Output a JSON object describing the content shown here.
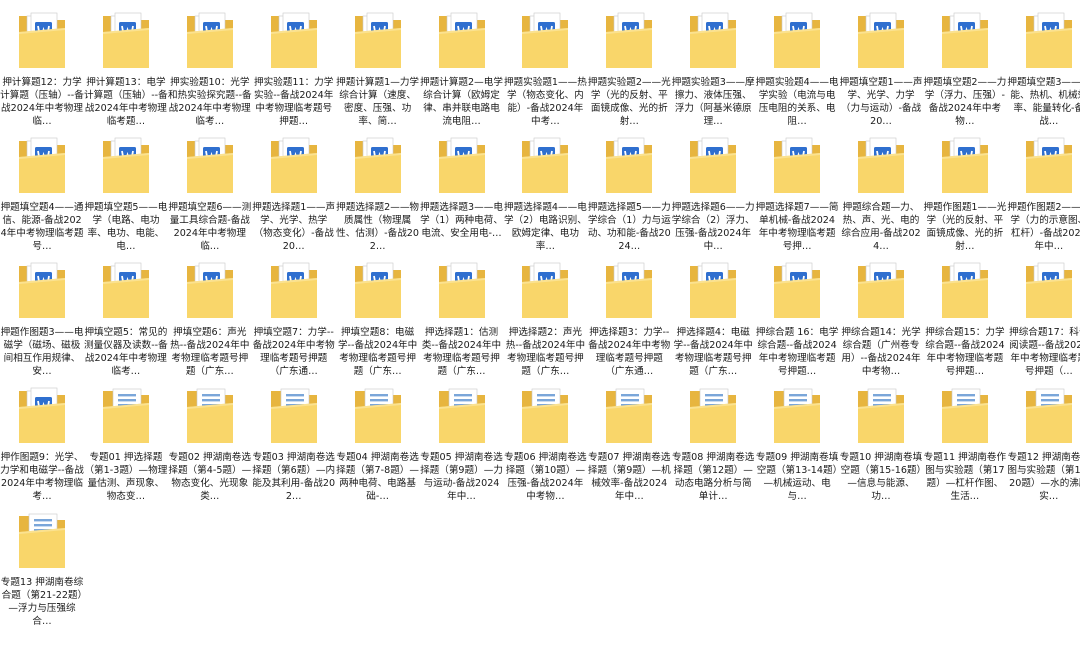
{
  "colors": {
    "folder_front": "#f9d66a",
    "folder_back": "#e7b53f",
    "doc_icon": "#2f6fcf",
    "paper": "#ffffff"
  },
  "items": [
    {
      "label": "押计算题12：力学计算题（压轴）--备战2024年中考物理临…",
      "icon": "word-doc-folder-icon"
    },
    {
      "label": "押计算题13：电学计算题（压轴）--备战2024年中考物理临考题…",
      "icon": "word-doc-folder-icon"
    },
    {
      "label": "押实验题10：光学和热实验探究题--备战2024年中考物理临考…",
      "icon": "word-doc-folder-icon"
    },
    {
      "label": "押实验题11：力学实验--备战2024年中考物理临考题号押题…",
      "icon": "word-doc-folder-icon"
    },
    {
      "label": "押题计算题1—力学综合计算（速度、密度、压强、功率、简…",
      "icon": "word-doc-folder-icon"
    },
    {
      "label": "押题计算题2—电学综合计算（欧姆定律、串并联电路电流电阻…",
      "icon": "word-doc-folder-icon"
    },
    {
      "label": "押题实验题1——热学（物态变化、内能）-备战2024年中考…",
      "icon": "word-doc-folder-icon"
    },
    {
      "label": "押题实验题2——光学（光的反射、平面镜成像、光的折射…",
      "icon": "word-doc-folder-icon"
    },
    {
      "label": "押题实验题3——摩擦力、液体压强、浮力（阿基米德原理…",
      "icon": "word-doc-folder-icon"
    },
    {
      "label": "押题实验题4——电学实验（电流与电压电阻的关系、电阻…",
      "icon": "word-doc-folder-icon"
    },
    {
      "label": "押题填空题1——声学、光学、力学（力与运动）-备战20…",
      "icon": "word-doc-folder-icon"
    },
    {
      "label": "押题填空题2——力学（浮力、压强）-备战2024年中考物…",
      "icon": "word-doc-folder-icon"
    },
    {
      "label": "押题填空题3——内能、热机、机械效率、能量转化-备战…",
      "icon": "word-doc-folder-icon"
    },
    {
      "label": "押题填空题4——通信、能源-备战2024年中考物理临考题号…",
      "icon": "word-doc-folder-icon"
    },
    {
      "label": "押题填空题5——电学（电路、电功率、电功、电能、电…",
      "icon": "word-doc-folder-icon"
    },
    {
      "label": "押题填空题6——测量工具综合题-备战2024年中考物理临…",
      "icon": "word-doc-folder-icon"
    },
    {
      "label": "押题选择题1——声学、光学、热学（物态变化）-备战20…",
      "icon": "word-doc-folder-icon"
    },
    {
      "label": "押题选择题2——物质属性（物理属性、估测）-备战202…",
      "icon": "word-doc-folder-icon"
    },
    {
      "label": "押题选择题3——电学（1）两种电荷、电流、安全用电-…",
      "icon": "word-doc-folder-icon"
    },
    {
      "label": "押题选择题4——电学（2）电路识别、欧姆定律、电功率…",
      "icon": "word-doc-folder-icon"
    },
    {
      "label": "押题选择题5——力学综合（1）力与运动、功和能-备战2024…",
      "icon": "word-doc-folder-icon"
    },
    {
      "label": "押题选择题6——力学综合（2）浮力、压强-备战2024年中…",
      "icon": "word-doc-folder-icon"
    },
    {
      "label": "押题选择题7——简单机械-备战2024年中考物理临考题号押…",
      "icon": "word-doc-folder-icon"
    },
    {
      "label": "押题综合题—力、热、声、光、电的综合应用-备战2024…",
      "icon": "word-doc-folder-icon"
    },
    {
      "label": "押题作图题1——光学（光的反射、平面镜成像、光的折射…",
      "icon": "word-doc-folder-icon"
    },
    {
      "label": "押题作图题2——力学（力的示意图、杠杆）-备战2024年中…",
      "icon": "word-doc-folder-icon"
    },
    {
      "label": "押题作图题3——电磁学（磁场、磁极间相互作用规律、安…",
      "icon": "word-doc-folder-icon"
    },
    {
      "label": "押填空题5：常见的测量仪器及读数--备战2024年中考物理临考…",
      "icon": "word-doc-folder-icon"
    },
    {
      "label": "押填空题6：声光热--备战2024年中考物理临考题号押题（广东…",
      "icon": "word-doc-folder-icon"
    },
    {
      "label": "押填空题7：力学--备战2024年中考物理临考题号押题（广东通…",
      "icon": "word-doc-folder-icon"
    },
    {
      "label": "押填空题8：电磁学--备战2024年中考物理临考题号押题（广东…",
      "icon": "word-doc-folder-icon"
    },
    {
      "label": "押选择题1：估测类--备战2024年中考物理临考题号押题（广东…",
      "icon": "word-doc-folder-icon"
    },
    {
      "label": "押选择题2：声光热--备战2024年中考物理临考题号押题（广东…",
      "icon": "word-doc-folder-icon"
    },
    {
      "label": "押选择题3：力学--备战2024年中考物理临考题号押题（广东通…",
      "icon": "word-doc-folder-icon"
    },
    {
      "label": "押选择题4：电磁学--备战2024年中考物理临考题号押题（广东…",
      "icon": "word-doc-folder-icon"
    },
    {
      "label": "押综合题 16：电学综合题--备战2024年中考物理临考题号押题…",
      "icon": "word-doc-folder-icon"
    },
    {
      "label": "押综合题14：光学综合题（广州卷专用）--备战2024年中考物…",
      "icon": "word-doc-folder-icon"
    },
    {
      "label": "押综合题15：力学综合题--备战2024年中考物理临考题号押题…",
      "icon": "word-doc-folder-icon"
    },
    {
      "label": "押综合题17：科普阅读题--备战2024年中考物理临考题号押题（…",
      "icon": "word-doc-folder-icon"
    },
    {
      "label": "押作图题9：光学、力学和电磁学--备战2024年中考物理临考…",
      "icon": "word-doc-folder-icon"
    },
    {
      "label": "专题01 押选择题（第1-3题）—物理量估测、声现象、物态变…",
      "icon": "blue-doc-folder-icon"
    },
    {
      "label": "专题02 押湖南卷选择题（第4-5题）—物态变化、光现象类…",
      "icon": "blue-doc-folder-icon"
    },
    {
      "label": "专题03 押湖南卷选择题（第6题）—内能及其利用-备战202…",
      "icon": "blue-doc-folder-icon"
    },
    {
      "label": "专题04 押湖南卷选择题（第7-8题）—两种电荷、电路基础-…",
      "icon": "blue-doc-folder-icon"
    },
    {
      "label": "专题05 押湖南卷选择题（第9题）—力与运动-备战2024年中…",
      "icon": "blue-doc-folder-icon"
    },
    {
      "label": "专题06 押湖南卷选择题（第10题）—压强-备战2024年中考物…",
      "icon": "blue-doc-folder-icon"
    },
    {
      "label": "专题07 押湖南卷选择题（第9题）—机械效率-备战2024年中…",
      "icon": "blue-doc-folder-icon"
    },
    {
      "label": "专题08 押湖南卷选择题（第12题）—动态电路分析与简单计…",
      "icon": "blue-doc-folder-icon"
    },
    {
      "label": "专题09 押湖南卷填空题（第13-14题）—机械运动、电与…",
      "icon": "blue-doc-folder-icon"
    },
    {
      "label": "专题10 押湖南卷填空题（第15-16题）—信息与能源、功…",
      "icon": "blue-doc-folder-icon"
    },
    {
      "label": "专题11 押湖南卷作图与实验题（第17题）—杠杆作图、生活…",
      "icon": "blue-doc-folder-icon"
    },
    {
      "label": "专题12 押湖南卷作图与实验题（第18-20题）—水的沸腾实…",
      "icon": "blue-doc-folder-icon"
    },
    {
      "label": "专题13 押湖南卷综合题（第21-22题）—浮力与压强综合…",
      "icon": "blue-doc-folder-icon"
    }
  ]
}
